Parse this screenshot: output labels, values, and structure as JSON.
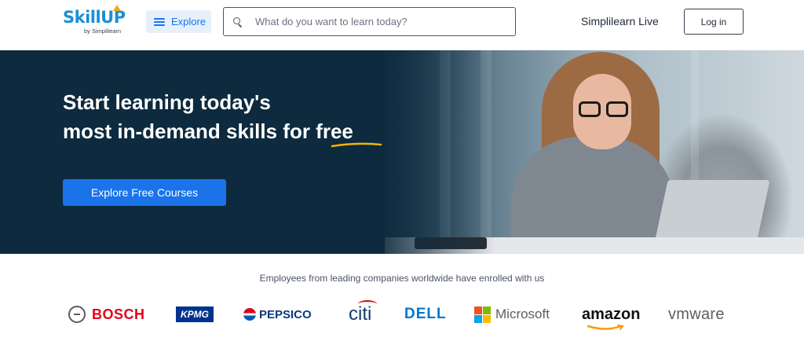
{
  "header": {
    "logo_text": "SkillUP",
    "logo_subtext": "by Simplilearn",
    "explore_label": "Explore",
    "search_placeholder": "What do you want to learn today?",
    "live_label": "Simplilearn Live",
    "login_label": "Log in"
  },
  "hero": {
    "title_line1": "Start learning today's",
    "title_line2_prefix": "most in-demand skills for ",
    "title_line2_highlight": "free",
    "cta_label": "Explore Free Courses",
    "accent_color": "#1a73e8",
    "underline_color": "#f5b400"
  },
  "companies": {
    "caption": "Employees from leading companies worldwide have enrolled with us",
    "logos": {
      "bosch": "BOSCH",
      "kpmg": "KPMG",
      "pepsico": "PEPSICO",
      "citi": "citi",
      "dell": "DELL",
      "microsoft": "Microsoft",
      "amazon": "amazon",
      "vmware": "vmware"
    }
  }
}
